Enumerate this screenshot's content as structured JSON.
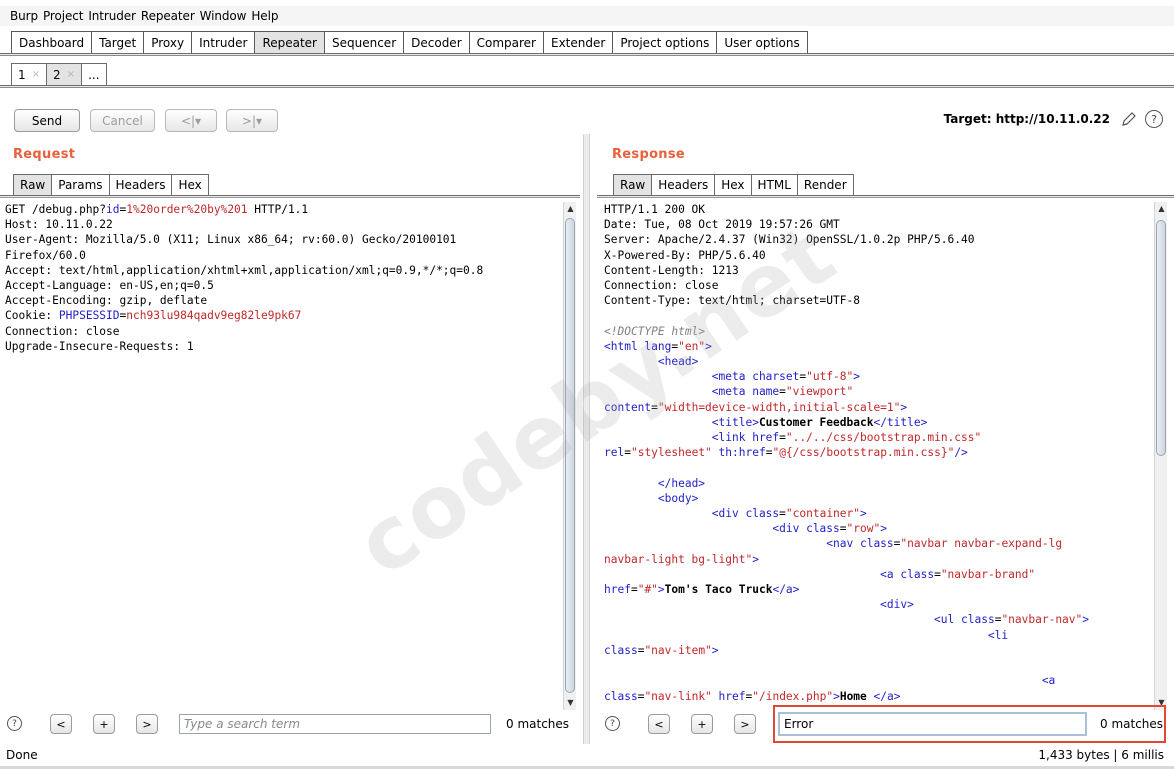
{
  "menubar": [
    "Burp",
    "Project",
    "Intruder",
    "Repeater",
    "Window",
    "Help"
  ],
  "main_tabs": [
    "Dashboard",
    "Target",
    "Proxy",
    "Intruder",
    "Repeater",
    "Sequencer",
    "Decoder",
    "Comparer",
    "Extender",
    "Project options",
    "User options"
  ],
  "sub_tabs": [
    "1",
    "2",
    "..."
  ],
  "toolbar": {
    "send": "Send",
    "cancel": "Cancel",
    "back": "<|▾",
    "forward": ">|▾",
    "target": "Target: http://10.11.0.22"
  },
  "request": {
    "title": "Request",
    "tabs": [
      "Raw",
      "Params",
      "Headers",
      "Hex"
    ],
    "lines": {
      "l1_method": "GET /debug.php?",
      "l1_param": "id",
      "l1_eq": "=",
      "l1_value": "1%20order%20by%201",
      "l1_proto": " HTTP/1.1",
      "l2": "Host: 10.11.0.22",
      "l3": "User-Agent: Mozilla/5.0 (X11; Linux x86_64; rv:60.0) Gecko/20100101",
      "l4": "Firefox/60.0",
      "l5": "Accept: text/html,application/xhtml+xml,application/xml;q=0.9,*/*;q=0.8",
      "l6": "Accept-Language: en-US,en;q=0.5",
      "l7": "Accept-Encoding: gzip, deflate",
      "l8_name": "Cookie: ",
      "l8_cookie": "PHPSESSID",
      "l8_eq": "=",
      "l8_value": "nch93lu984qadv9eg82le9pk67",
      "l9": "Connection: close",
      "l10": "Upgrade-Insecure-Requests: 1"
    },
    "search_placeholder": "Type a search term",
    "matches": "0 matches"
  },
  "response": {
    "title": "Response",
    "tabs": [
      "Raw",
      "Headers",
      "Hex",
      "HTML",
      "Render"
    ],
    "headers": [
      "HTTP/1.1 200 OK",
      "Date: Tue, 08 Oct 2019 19:57:26 GMT",
      "Server: Apache/2.4.37 (Win32) OpenSSL/1.0.2p PHP/5.6.40",
      "X-Powered-By: PHP/5.6.40",
      "Content-Length: 1213",
      "Connection: close",
      "Content-Type: text/html; charset=UTF-8"
    ],
    "search_value": "Error",
    "matches": "0 matches"
  },
  "status": {
    "left": "Done",
    "right": "1,433 bytes | 6 millis"
  },
  "watermark": "codeby.net",
  "help_glyph": "?",
  "search_buttons": [
    "<",
    "+",
    ">"
  ],
  "tab_close_glyph": "×"
}
